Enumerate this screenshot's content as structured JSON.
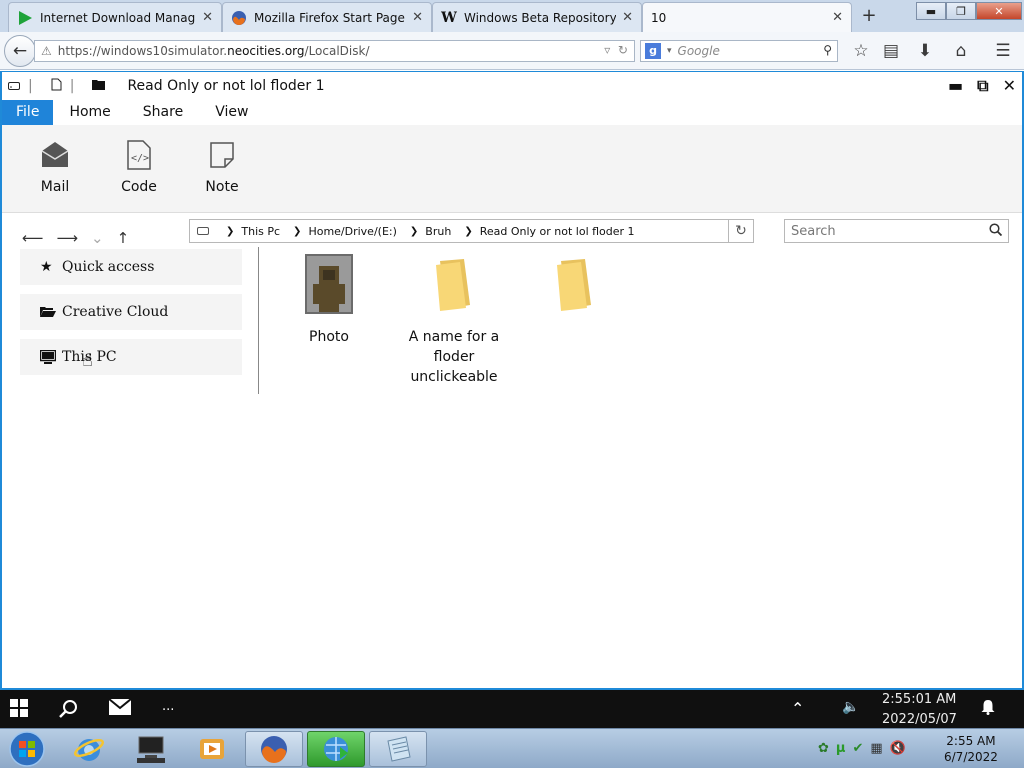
{
  "browser": {
    "tabs": [
      {
        "label": "Internet Download Manag...",
        "icon": "idm-play-icon"
      },
      {
        "label": "Mozilla Firefox Start Page",
        "icon": "firefox-icon"
      },
      {
        "label": "Windows Beta Repository -...",
        "icon": "w-logo-icon"
      },
      {
        "label": "10",
        "icon": ""
      }
    ],
    "url_prefix": "https://windows10simulator.",
    "url_host": "neocities.org",
    "url_path": "/LocalDisk/",
    "search_engine": "Google",
    "search_placeholder": "Google"
  },
  "explorer": {
    "title": "Read Only or not lol floder 1",
    "menu": [
      "File",
      "Home",
      "Share",
      "View"
    ],
    "ribbon": [
      {
        "label": "Mail",
        "icon": "mail-icon"
      },
      {
        "label": "Code",
        "icon": "code-file-icon"
      },
      {
        "label": "Note",
        "icon": "note-icon"
      }
    ],
    "breadcrumb": [
      "This Pc",
      "Home/Drive/(E:)",
      "Bruh",
      "Read Only or not lol floder 1"
    ],
    "search_placeholder": "Search",
    "sidebar": [
      {
        "label": "Quick access",
        "icon": "star-icon"
      },
      {
        "label": "Creative Cloud",
        "icon": "folder-open-icon"
      },
      {
        "label": "This PC",
        "icon": "monitor-icon"
      }
    ],
    "files": [
      {
        "label": "Photo",
        "type": "image"
      },
      {
        "label": "A name for a floder unclickeable",
        "type": "folder"
      },
      {
        "label": "",
        "type": "folder"
      }
    ]
  },
  "win10_taskbar": {
    "time": "2:55:01 AM",
    "date": "2022/05/07",
    "more": "..."
  },
  "win7_taskbar": {
    "time": "2:55 AM",
    "date": "6/7/2022"
  },
  "colors": {
    "accent": "#1f84d9",
    "folder": "#f8d776",
    "win10_taskbar": "#101010"
  }
}
